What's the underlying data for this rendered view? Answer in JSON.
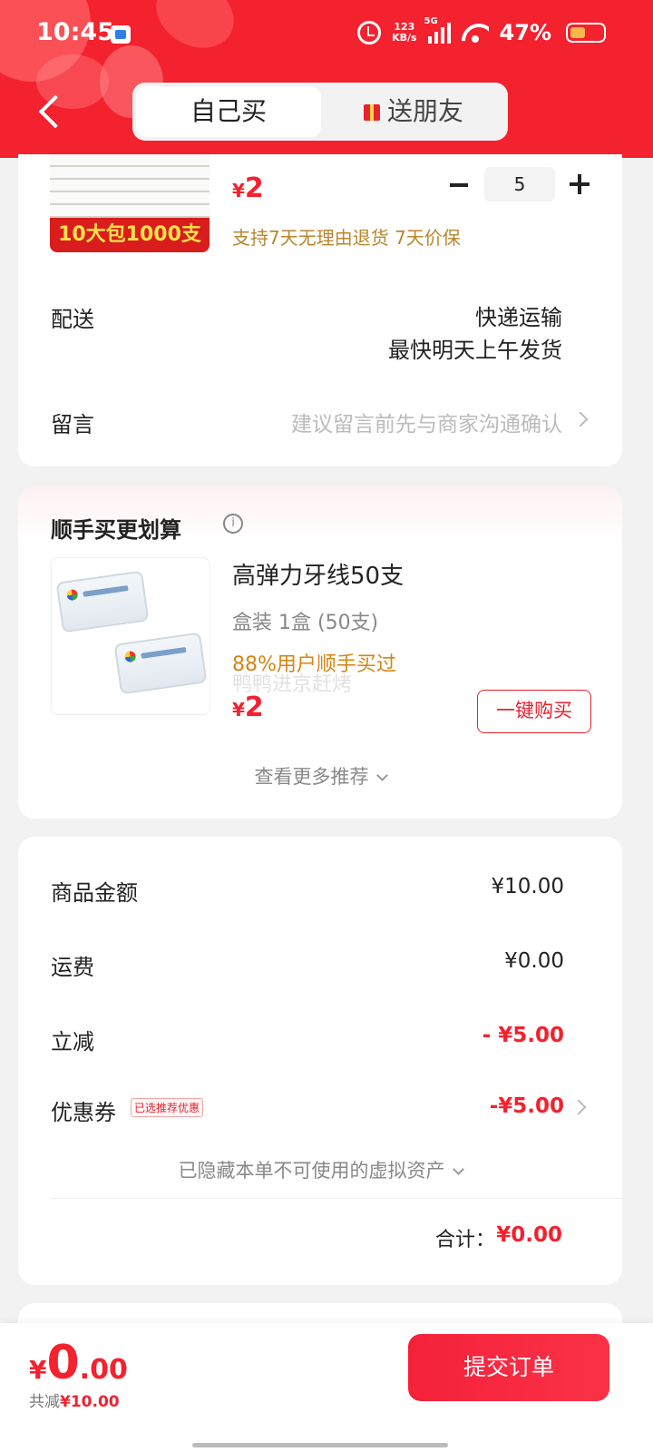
{
  "status_bar": {
    "time": "10:45",
    "net_speed_value": "123",
    "net_speed_unit": "KB/s",
    "network": "5G",
    "battery": "47%"
  },
  "header": {
    "tab_self": "自己买",
    "tab_friend": "送朋友",
    "active_tab": "自己买",
    "brand_color": "#f4212e"
  },
  "product": {
    "thumb_banner": "10大包1000支",
    "currency": "¥",
    "price": "2",
    "quantity": "5",
    "guarantee": "支持7天无理由退货 7天价保"
  },
  "delivery": {
    "label": "配送",
    "method": "快递运输",
    "ship_time": "最快明天上午发货"
  },
  "message": {
    "label": "留言",
    "placeholder": "建议留言前先与商家沟通确认"
  },
  "recommend": {
    "title": "顺手买更划算",
    "item_name": "高弹力牙线50支",
    "spec": "盒装   1盒 (50支)",
    "social_proof": "88%用户顺手买过",
    "watermark": "鸭鸭进京赶烤",
    "currency": "¥",
    "price": "2",
    "buy_label": "一键购买",
    "more_label": "查看更多推荐"
  },
  "summary": {
    "goods_label": "商品金额",
    "goods_value": "¥10.00",
    "shipping_label": "运费",
    "shipping_value": "¥0.00",
    "discount_label": "立减",
    "discount_value": "- ¥5.00",
    "coupon_label": "优惠券",
    "coupon_tag": "已选推荐优惠",
    "coupon_value": "-¥5.00",
    "hidden_assets": "已隐藏本单不可使用的虚拟资产",
    "total_label": "合计：",
    "total_value": "¥0.00"
  },
  "bottom_bar": {
    "currency": "¥",
    "price_int": "0",
    "price_dec": ".00",
    "saved_label": "共减",
    "saved_amount": "¥10.00",
    "submit_label": "提交订单"
  }
}
